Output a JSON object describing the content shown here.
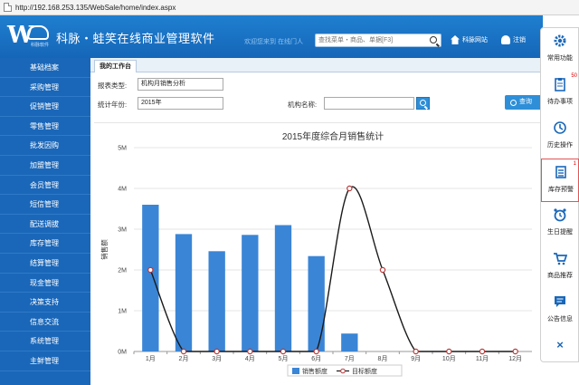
{
  "browser": {
    "url": "http://192.168.253.135/WebSale/home/index.aspx"
  },
  "header": {
    "logo_sub": "科脉软件",
    "title": "科脉・蛙笑在线商业管理软件",
    "welcome": "欢迎您来到 在线门人",
    "search_placeholder": "查找菜单・商品、单据[F3]",
    "home_link": "科脉网站",
    "logout_link": "注销"
  },
  "sidebar": {
    "items": [
      {
        "label": "基础档案"
      },
      {
        "label": "采购管理"
      },
      {
        "label": "促销管理"
      },
      {
        "label": "零售管理"
      },
      {
        "label": "批发因购"
      },
      {
        "label": "加盟管理"
      },
      {
        "label": "会员管理"
      },
      {
        "label": "短信管理"
      },
      {
        "label": "配送调拔"
      },
      {
        "label": "库存管理"
      },
      {
        "label": "结算管理"
      },
      {
        "label": "现金管理"
      },
      {
        "label": "决策支持"
      },
      {
        "label": "信息交流"
      },
      {
        "label": "系统管理"
      },
      {
        "label": "主鲜管理"
      }
    ]
  },
  "main": {
    "tab": "我的工作台",
    "report_type_label": "报表类型:",
    "report_type_value": "机构月销售分析",
    "year_label": "统计年份:",
    "year_value": "2015年",
    "org_label": "机构名称:",
    "org_value": "",
    "query_label": "查询"
  },
  "quick_panel": {
    "items": [
      {
        "label": "常用功能",
        "icon": "gear-icon",
        "badge": ""
      },
      {
        "label": "待办事项",
        "icon": "clipboard-icon",
        "badge": "50"
      },
      {
        "label": "历史操作",
        "icon": "history-icon",
        "badge": ""
      },
      {
        "label": "库存预警",
        "icon": "list-icon",
        "badge": "1"
      },
      {
        "label": "生日提醒",
        "icon": "alarm-clock-icon",
        "badge": ""
      },
      {
        "label": "商品推荐",
        "icon": "cart-icon",
        "badge": ""
      },
      {
        "label": "公告信息",
        "icon": "message-icon",
        "badge": ""
      }
    ],
    "close": "×"
  },
  "colors": {
    "accent": "#1a67b9",
    "bar": "#3a85d6",
    "line": "#1a1a1a",
    "marker": "#b83a3a"
  },
  "chart_data": {
    "type": "bar",
    "title": "2015年度综合月销售统计",
    "ylabel": "销售额",
    "categories": [
      "1月",
      "2月",
      "3月",
      "4月",
      "5月",
      "6月",
      "7月",
      "8月",
      "9月",
      "10月",
      "11月",
      "12月"
    ],
    "y_ticks": [
      "0M",
      "1M",
      "2M",
      "3M",
      "4M",
      "5M"
    ],
    "ylim": [
      0,
      5000000
    ],
    "series": [
      {
        "name": "销售额度",
        "kind": "bar",
        "values": [
          3600000,
          2880000,
          2460000,
          2860000,
          3100000,
          2340000,
          440000,
          0,
          0,
          0,
          0,
          0
        ]
      },
      {
        "name": "目标额度",
        "kind": "line",
        "values": [
          2000000,
          0,
          0,
          0,
          0,
          0,
          4000000,
          2000000,
          0,
          0,
          0,
          0
        ]
      }
    ],
    "legend": "bottom",
    "grid": true
  }
}
